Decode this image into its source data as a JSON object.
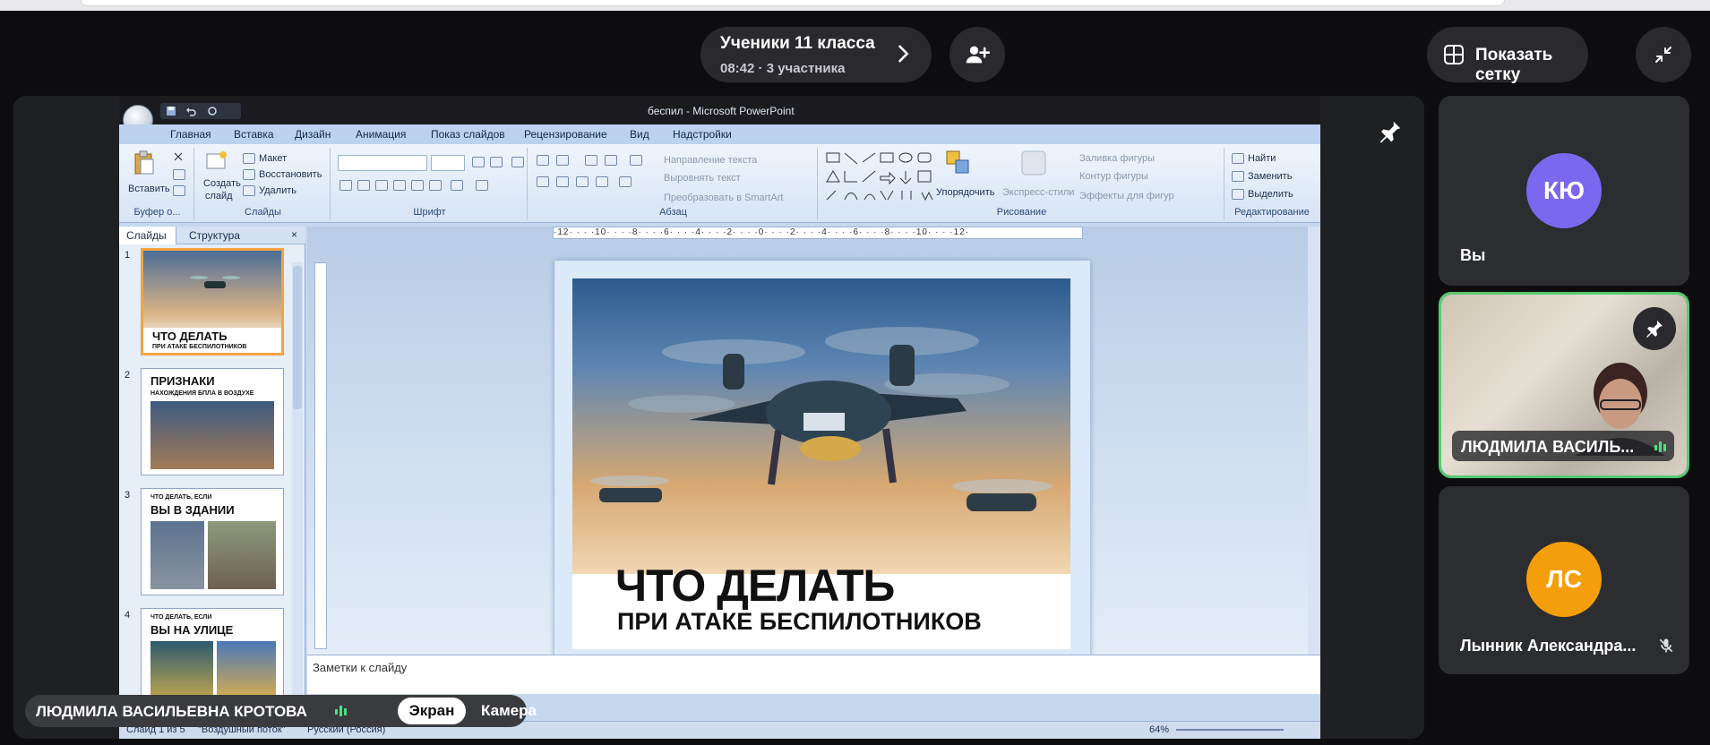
{
  "call": {
    "title": "Ученики 11 класса",
    "subtitle": "08:42 · 3 участника",
    "show_grid_label": "Показать сетку"
  },
  "participants": [
    {
      "initials": "КЮ",
      "name": "Вы",
      "avatar_color": "#7b68ee"
    },
    {
      "name": "ЛЮДМИЛА ВАСИЛЬ...",
      "speaking": true
    },
    {
      "initials": "ЛС",
      "name": "Лынник Александра...",
      "avatar_color": "#f59e0b",
      "muted": true
    }
  ],
  "presenter": {
    "name": "ЛЮДМИЛА ВАСИЛЬЕВНА КРОТОВА",
    "toggle_screen": "Экран",
    "toggle_camera": "Камера"
  },
  "powerpoint": {
    "window_title": "беспил - Microsoft PowerPoint",
    "tabs": [
      "Главная",
      "Вставка",
      "Дизайн",
      "Анимация",
      "Показ слайдов",
      "Рецензирование",
      "Вид",
      "Надстройки"
    ],
    "ribbon": {
      "clipboard": {
        "paste": "Вставить",
        "group": "Буфер о..."
      },
      "slides": {
        "create": "Создать",
        "create2": "слайд",
        "layout": "Макет",
        "reset": "Восстановить",
        "delete": "Удалить",
        "group": "Слайды"
      },
      "font": {
        "group": "Шрифт"
      },
      "paragraph": {
        "text_direction": "Направление текста",
        "align_text": "Выровнять текст",
        "smartart": "Преобразовать в SmartArt",
        "group": "Абзац"
      },
      "drawing": {
        "arrange": "Упорядочить",
        "quick_styles": "Экспресс-стили",
        "fill": "Заливка фигуры",
        "outline": "Контур фигуры",
        "effects": "Эффекты для фигур",
        "group": "Рисование"
      },
      "editing": {
        "find": "Найти",
        "replace": "Заменить",
        "select": "Выделить",
        "group": "Редактирование"
      }
    },
    "pane_tabs": [
      "Слайды",
      "Структура"
    ],
    "thumbnails": [
      {
        "num": "1",
        "line1": "ЧТО ДЕЛАТЬ",
        "line2": "ПРИ АТАКЕ БЕСПИЛОТНИКОВ"
      },
      {
        "num": "2",
        "line1": "ПРИЗНАКИ",
        "line2": "НАХОЖДЕНИЯ БПЛА В ВОЗДУХЕ"
      },
      {
        "num": "3",
        "line1": "ВЫ В ЗДАНИИ",
        "line2": "ЧТО ДЕЛАТЬ, ЕСЛИ"
      },
      {
        "num": "4",
        "line1": "ВЫ НА УЛИЦЕ",
        "line2": "ЧТО ДЕЛАТЬ, ЕСЛИ"
      }
    ],
    "ruler": "·12· · · ·10· · · ·8· · · ·6· · · ·4· · · ·2· · · ·0· · · ·2· · · ·4· · · ·6· · · ·8· · · ·10· · · ·12·",
    "slide": {
      "heading": "ЧТО ДЕЛАТЬ",
      "subheading": "ПРИ АТАКЕ БЕСПИЛОТНИКОВ"
    },
    "notes_label": "Заметки к слайду",
    "status": {
      "slide": "Слайд 1 из 5",
      "theme": "\"Воздушный поток\"",
      "language": "Русский (Россия)",
      "zoom": "64%"
    }
  }
}
